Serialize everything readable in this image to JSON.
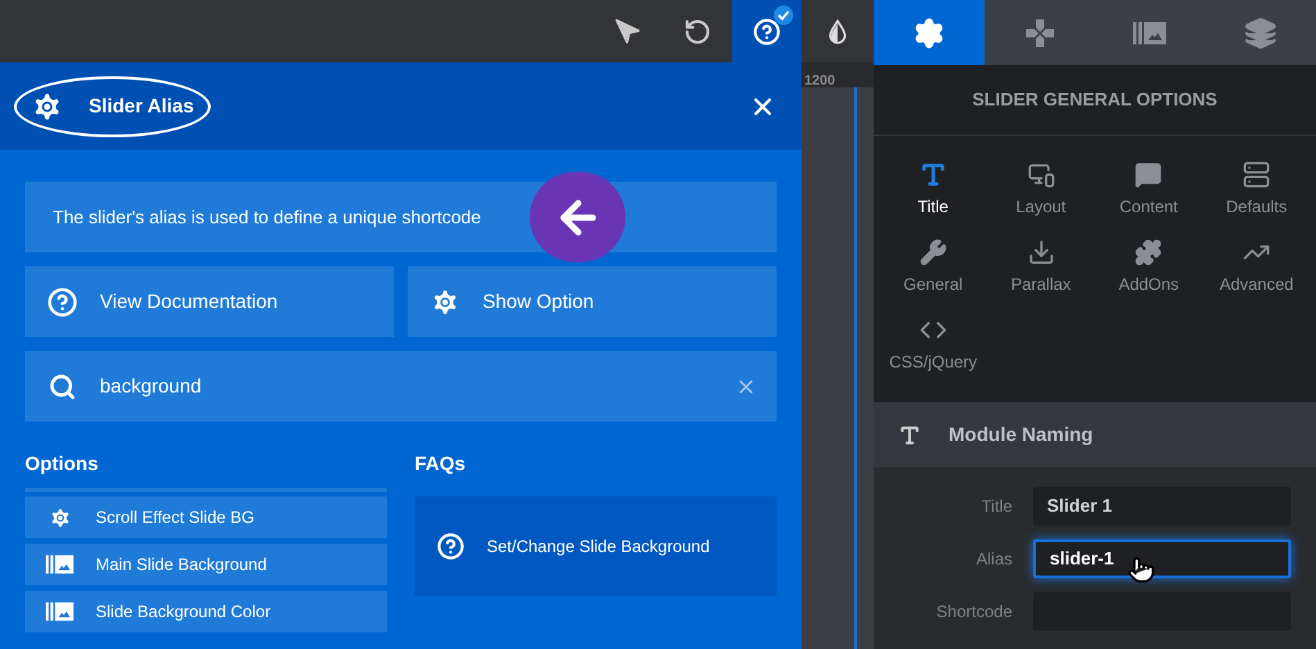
{
  "toolbar": [
    {
      "kind": "pointer",
      "selected": false
    },
    {
      "kind": "undo",
      "selected": false
    },
    {
      "kind": "help",
      "selected": true
    }
  ],
  "help_panel": {
    "title": "Slider Alias",
    "info": "The slider's alias is used to define a unique shortcode",
    "buttons": [
      {
        "kind": "help",
        "label": "View Documentation"
      },
      {
        "kind": "gear",
        "label": "Show Option"
      }
    ],
    "search": {
      "value": "background"
    },
    "options": {
      "heading": "Options",
      "items": [
        {
          "kind": "gear",
          "label": "Scroll Effect Slide BG"
        },
        {
          "kind": "image",
          "label": "Main Slide Background"
        },
        {
          "kind": "image",
          "label": "Slide Background Color"
        }
      ]
    },
    "faqs": {
      "heading": "FAQs",
      "items": [
        {
          "label": "Set/Change Slide Background"
        }
      ]
    }
  },
  "canvas": {
    "ruler_label": "1200"
  },
  "settings_panel": {
    "tabs": [
      {
        "kind": "gear",
        "selected": true
      },
      {
        "kind": "dpad",
        "selected": false
      },
      {
        "kind": "image",
        "selected": false
      },
      {
        "kind": "layers",
        "selected": false
      }
    ],
    "heading": "SLIDER GENERAL OPTIONS",
    "menu": [
      {
        "kind": "title",
        "label": "Title",
        "selected": true
      },
      {
        "kind": "layout",
        "label": "Layout",
        "selected": false
      },
      {
        "kind": "content",
        "label": "Content",
        "selected": false
      },
      {
        "kind": "defaults",
        "label": "Defaults",
        "selected": false
      },
      {
        "kind": "general",
        "label": "General",
        "selected": false
      },
      {
        "kind": "parallax",
        "label": "Parallax",
        "selected": false
      },
      {
        "kind": "addons",
        "label": "AddOns",
        "selected": false
      },
      {
        "kind": "advanced",
        "label": "Advanced",
        "selected": false
      },
      {
        "kind": "code",
        "label": "CSS/jQuery",
        "selected": false
      }
    ],
    "section": {
      "title": "Module Naming",
      "fields": [
        {
          "label": "Title",
          "value": "Slider 1",
          "focused": false
        },
        {
          "label": "Alias",
          "value": "slider-1",
          "focused": true
        },
        {
          "label": "Shortcode",
          "focused": false
        }
      ]
    }
  }
}
